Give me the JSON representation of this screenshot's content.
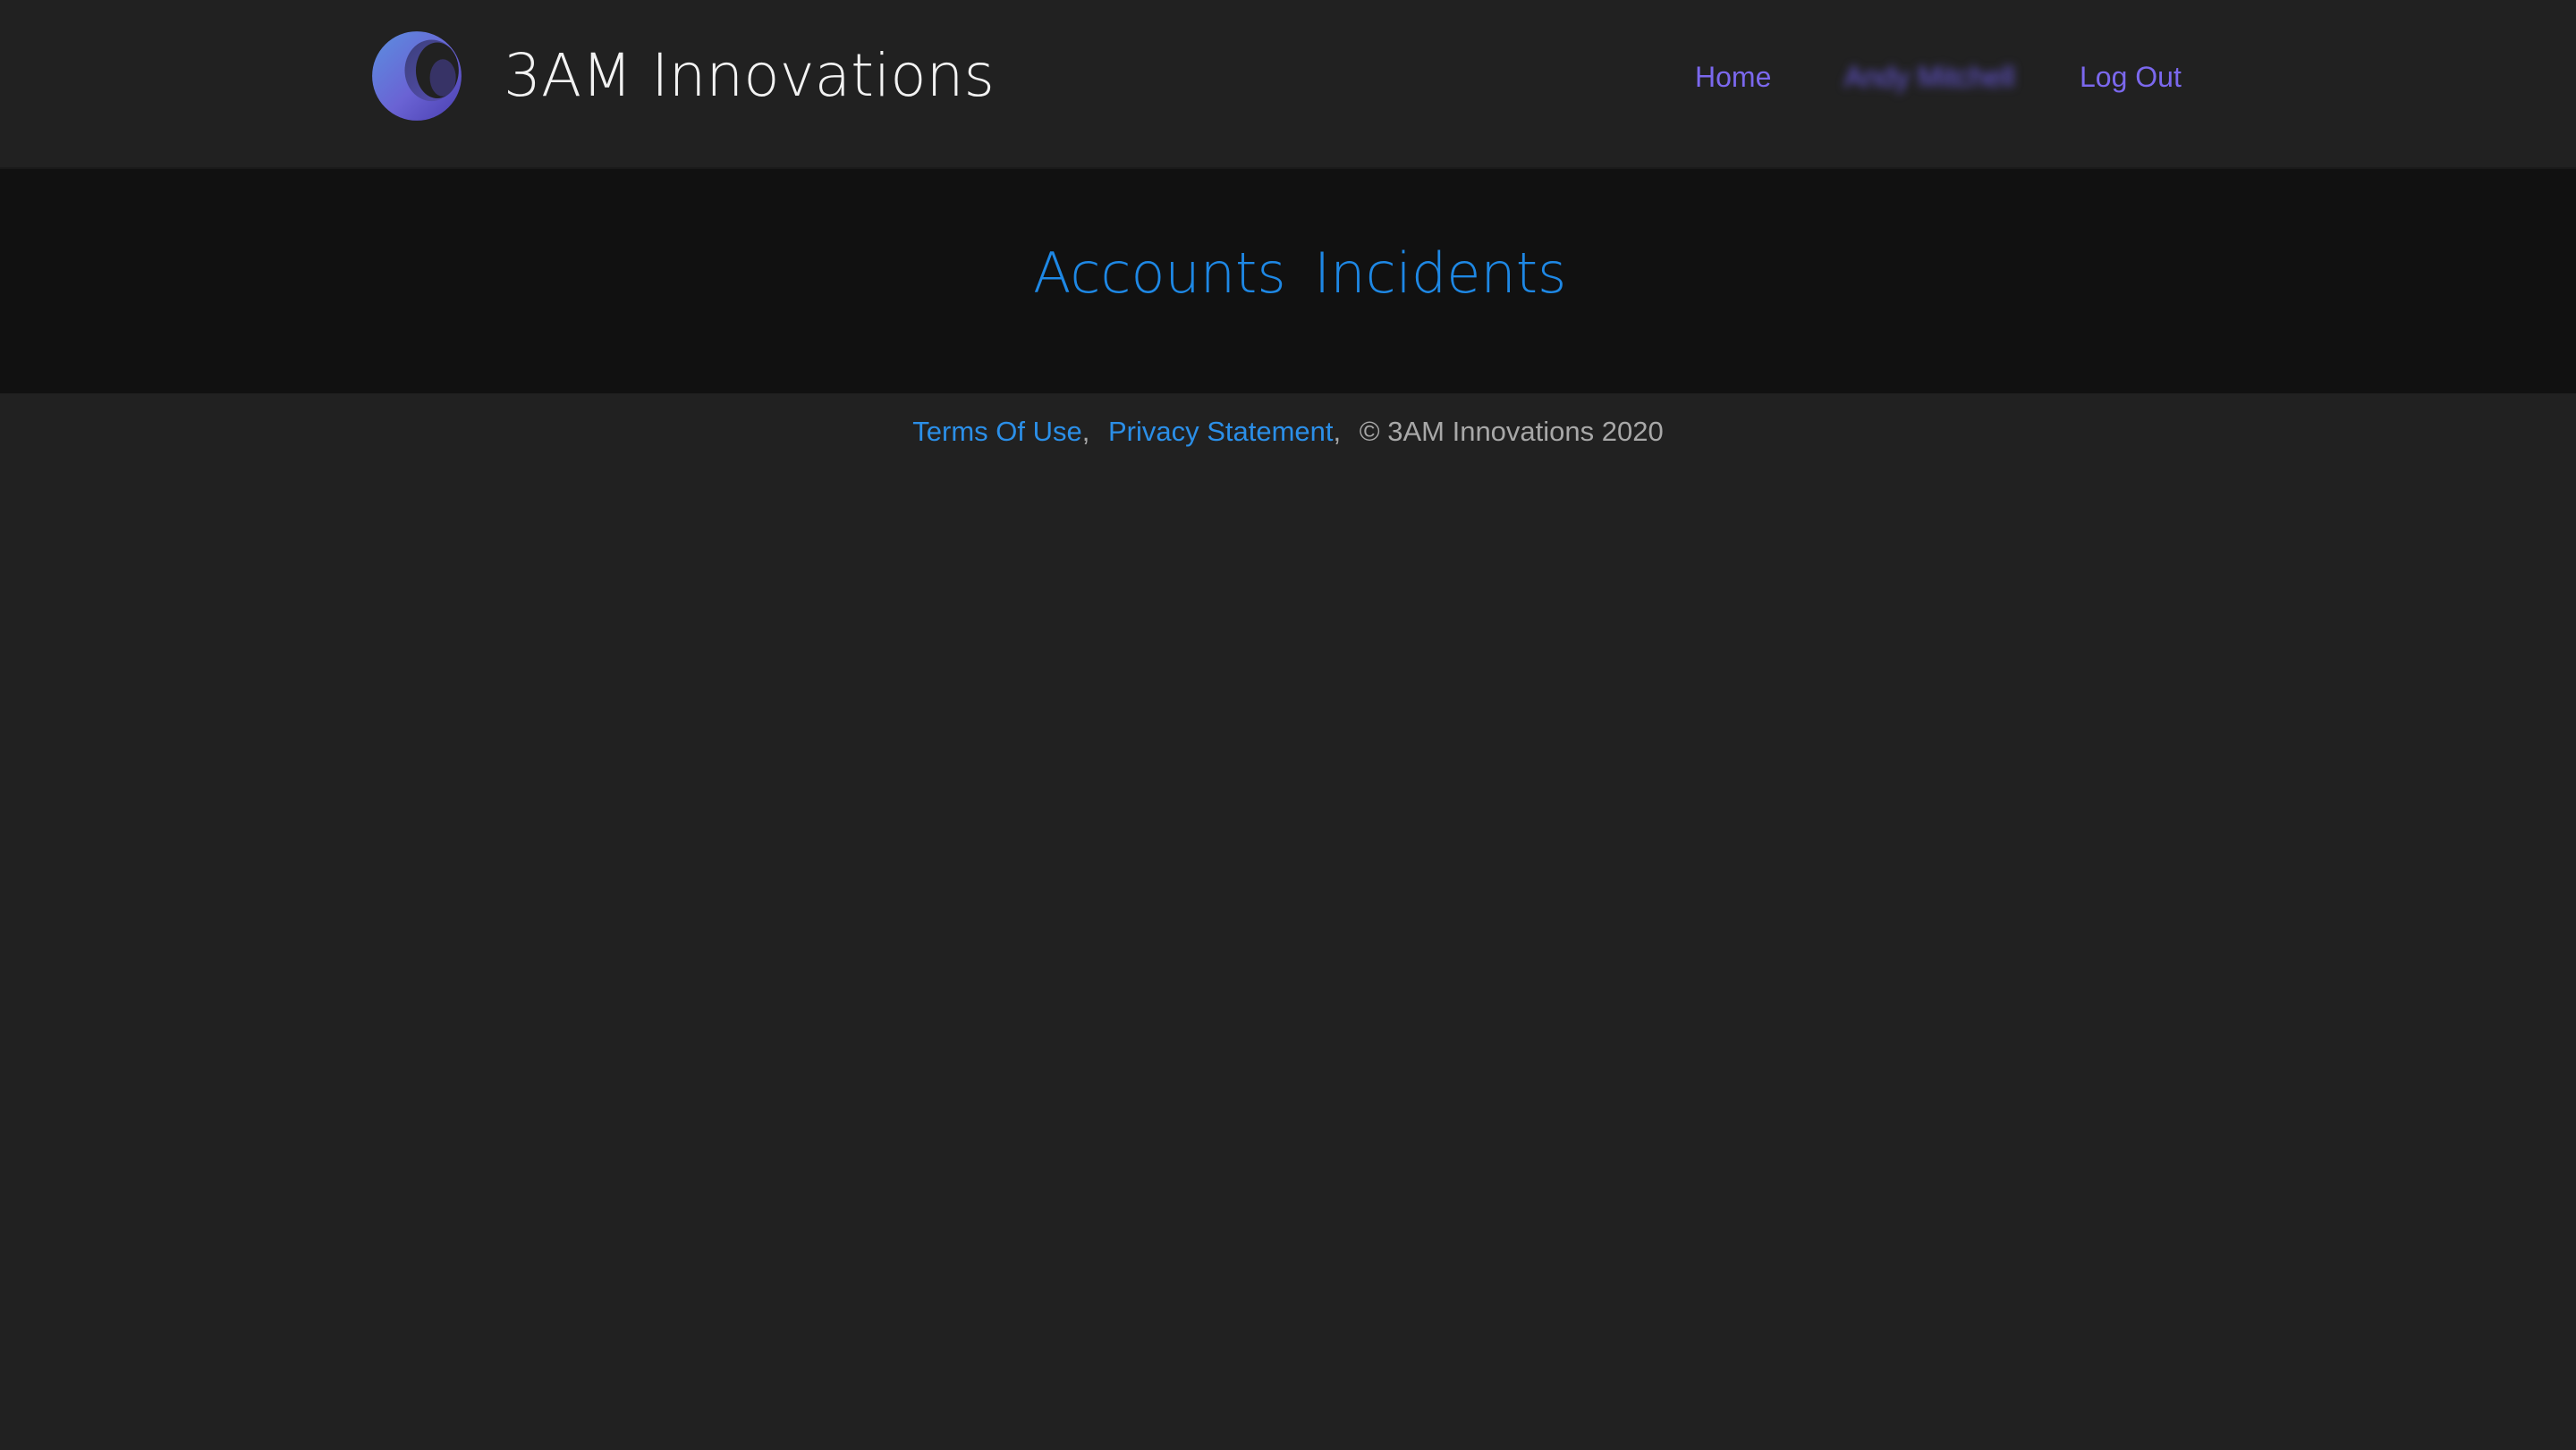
{
  "header": {
    "brand": "3AM Innovations",
    "logo_icon": "crescent-moon-logo-icon",
    "nav": {
      "home": "Home",
      "user_name": "Andy Mitchell",
      "log_out": "Log Out"
    }
  },
  "main": {
    "links": {
      "accounts": "Accounts",
      "incidents": "Incidents"
    }
  },
  "footer": {
    "terms": "Terms Of Use",
    "privacy": "Privacy Statement",
    "separator": ",",
    "copyright": "© 3AM Innovations 2020"
  },
  "colors": {
    "background": "#212121",
    "band": "#111111",
    "nav_link": "#7b68ee",
    "link_blue": "#1e88e5",
    "footer_text": "#a8a8a8"
  }
}
